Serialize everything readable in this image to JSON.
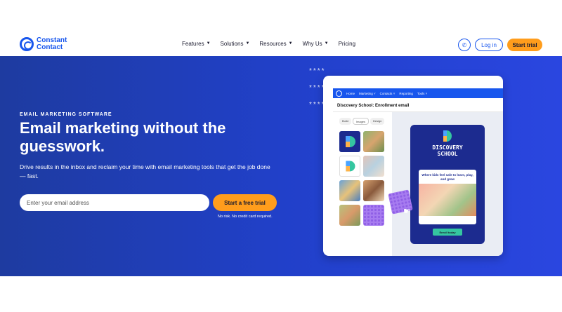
{
  "brand": {
    "name_line1": "Constant",
    "name_line2": "Contact",
    "accent": "#1856ed",
    "cta_color": "#ff9d1c"
  },
  "nav": {
    "items": [
      {
        "label": "Features",
        "has_dropdown": true
      },
      {
        "label": "Solutions",
        "has_dropdown": true
      },
      {
        "label": "Resources",
        "has_dropdown": true
      },
      {
        "label": "Why Us",
        "has_dropdown": true
      },
      {
        "label": "Pricing",
        "has_dropdown": false
      }
    ],
    "phone_icon": "phone-icon",
    "login_label": "Log in",
    "trial_label": "Start trial"
  },
  "hero": {
    "eyebrow": "EMAIL MARKETING SOFTWARE",
    "headline": "Email marketing without the guesswork.",
    "subhead": "Drive results in the inbox and reclaim your time with email marketing tools that get the job done — fast.",
    "email_placeholder": "Enter your email address",
    "cta_label": "Start a free trial",
    "fine_print": "No risk. No credit card required."
  },
  "mock_app": {
    "nav_items": [
      "Home",
      "Marketing",
      "Contacts",
      "Reporting",
      "Tools"
    ],
    "nav_dropdowns": [
      false,
      true,
      true,
      false,
      true
    ],
    "title": "Discovery School: Enrollment email",
    "tabs": [
      "Build",
      "Images",
      "Design"
    ],
    "active_tab": "Images",
    "email_preview": {
      "school_line1": "DISCOVERY",
      "school_line2": "SCHOOL",
      "card_text": "Where kids feel safe to learn, play, and grow",
      "button_label": "Enroll today"
    }
  },
  "decor": {
    "asterisks": "****"
  }
}
